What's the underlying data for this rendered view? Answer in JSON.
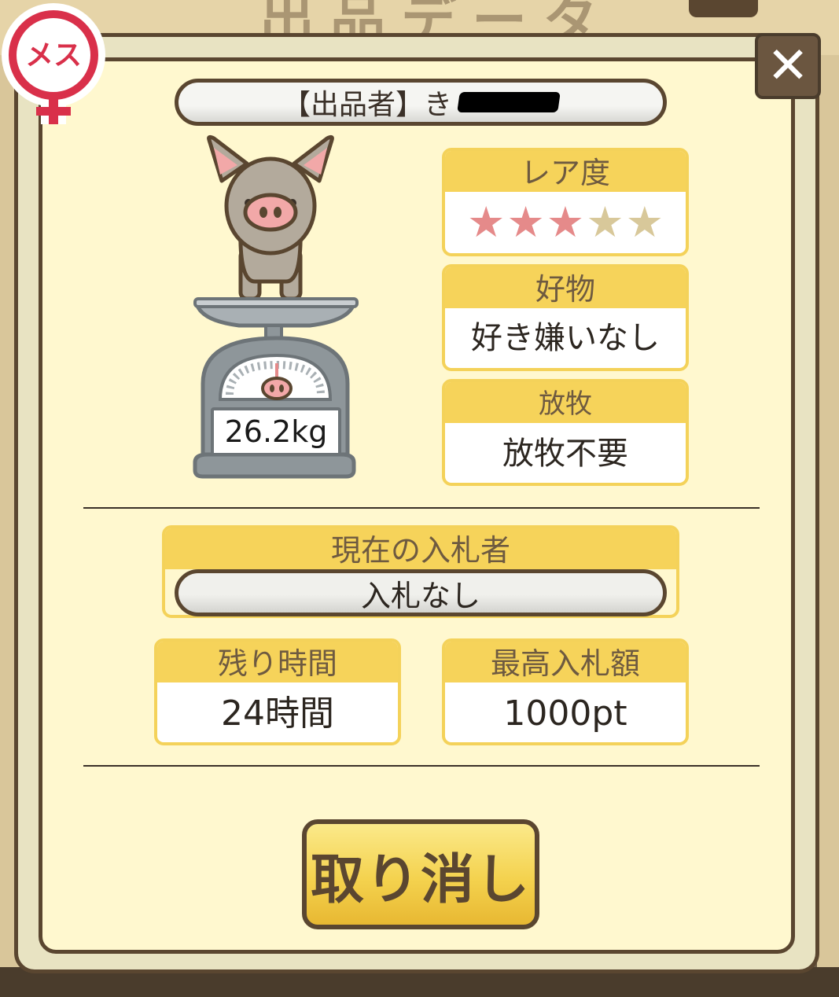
{
  "background": {
    "title": "出品データ"
  },
  "seller": {
    "label": "【出品者】き"
  },
  "rarity": {
    "label": "レア度",
    "stars_filled": 3,
    "stars_total": 5
  },
  "favorite": {
    "label": "好物",
    "value": "好き嫌いなし"
  },
  "grazing": {
    "label": "放牧",
    "value": "放牧不要"
  },
  "pig": {
    "weight": "26.2kg"
  },
  "current_bidder": {
    "label": "現在の入札者",
    "value": "入札なし"
  },
  "time_left": {
    "label": "残り時間",
    "value": "24時間"
  },
  "highest_bid": {
    "label": "最高入札額",
    "value": "1000pt"
  },
  "actions": {
    "cancel_label": "取り消し"
  },
  "badge": {
    "gender": "メス"
  },
  "colors": {
    "accent": "#f6d35a",
    "border": "#5a4630",
    "panel": "#fff8cf",
    "star_on": "#e58a8a",
    "star_off": "#d8c89a"
  },
  "icons": {
    "close": "close-icon",
    "female": "female-icon"
  }
}
